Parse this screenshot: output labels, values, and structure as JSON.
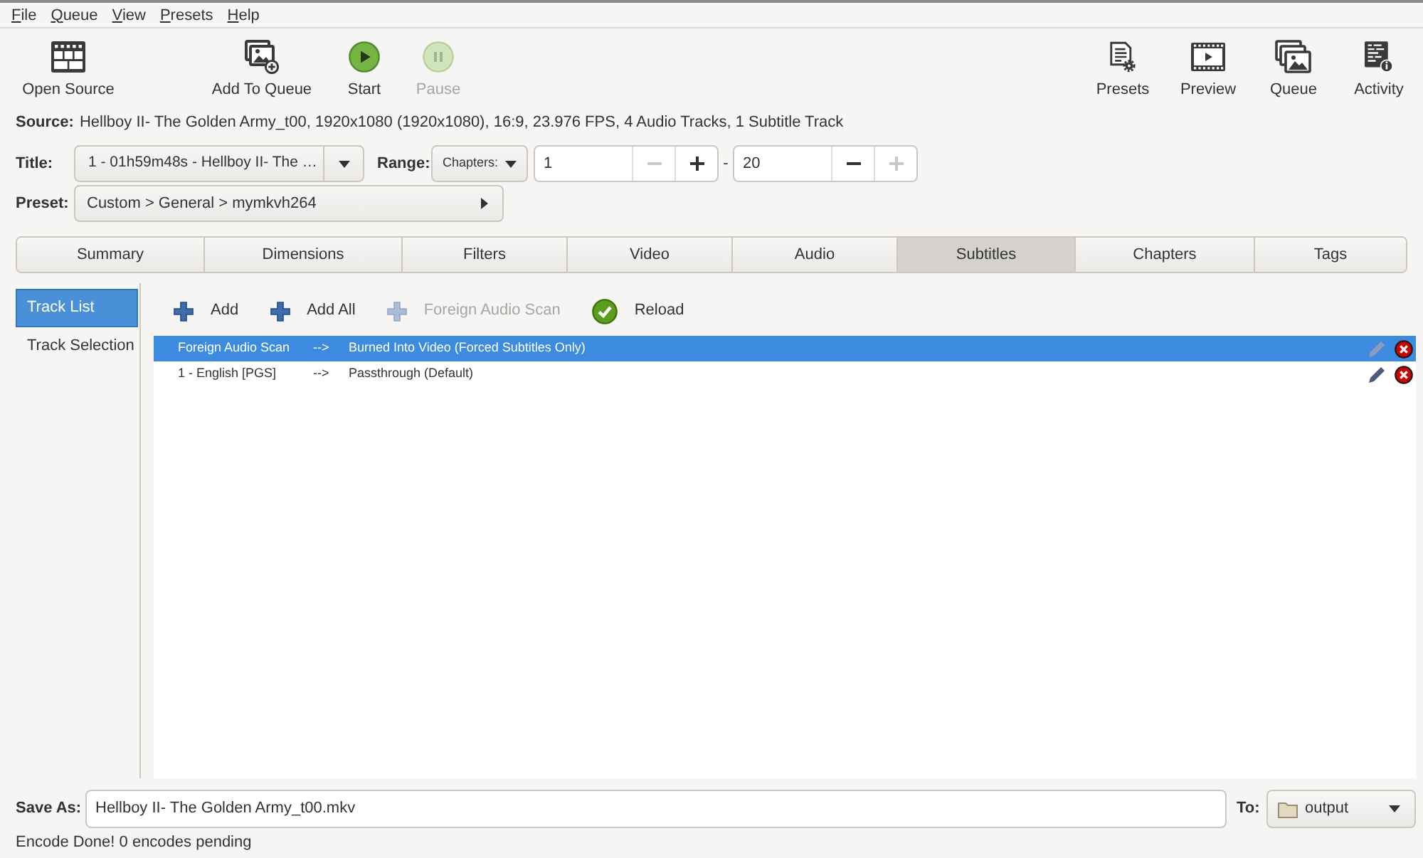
{
  "menu": [
    "File",
    "Queue",
    "View",
    "Presets",
    "Help"
  ],
  "toolbar": {
    "left": [
      {
        "label": "Open Source",
        "disabled": false
      },
      {
        "label": "Add To Queue",
        "disabled": false
      },
      {
        "label": "Start",
        "disabled": false
      },
      {
        "label": "Pause",
        "disabled": true
      }
    ],
    "right": [
      {
        "label": "Presets",
        "disabled": false
      },
      {
        "label": "Preview",
        "disabled": false
      },
      {
        "label": "Queue",
        "disabled": false
      },
      {
        "label": "Activity",
        "disabled": false
      }
    ]
  },
  "source": {
    "label": "Source:",
    "value": "Hellboy II- The Golden Army_t00, 1920x1080 (1920x1080), 16:9, 23.976 FPS, 4 Audio Tracks, 1 Subtitle Track"
  },
  "title": {
    "label": "Title:",
    "value": "1 - 01h59m48s - Hellboy II- The …"
  },
  "range": {
    "label": "Range:",
    "mode": "Chapters:",
    "start": {
      "value": "1",
      "decrement_disabled": true,
      "increment_disabled": false
    },
    "separator": "-",
    "end": {
      "value": "20",
      "decrement_disabled": false,
      "increment_disabled": true
    }
  },
  "preset": {
    "label": "Preset:",
    "value": "Custom > General > mymkvh264"
  },
  "tabs": [
    {
      "label": "Summary",
      "selected": false
    },
    {
      "label": "Dimensions",
      "selected": false
    },
    {
      "label": "Filters",
      "selected": false
    },
    {
      "label": "Video",
      "selected": false
    },
    {
      "label": "Audio",
      "selected": false
    },
    {
      "label": "Subtitles",
      "selected": true
    },
    {
      "label": "Chapters",
      "selected": false
    },
    {
      "label": "Tags",
      "selected": false
    }
  ],
  "sidebar": [
    {
      "label": "Track List",
      "selected": true
    },
    {
      "label": "Track Selection",
      "selected": false
    }
  ],
  "subtitle_toolbar": [
    {
      "label": "Add",
      "disabled": false
    },
    {
      "label": "Add All",
      "disabled": false
    },
    {
      "label": "Foreign Audio Scan",
      "disabled": true
    },
    {
      "label": "Reload",
      "disabled": false
    }
  ],
  "tracks": [
    {
      "source": "Foreign Audio Scan",
      "arrow": "-->",
      "output": "Burned Into Video (Forced Subtitles Only)",
      "selected": true
    },
    {
      "source": "1 - English [PGS]",
      "arrow": "-->",
      "output": "Passthrough (Default)",
      "selected": false
    }
  ],
  "save_as": {
    "label": "Save As:",
    "value": "Hellboy II- The Golden Army_t00.mkv"
  },
  "destination": {
    "label": "To:",
    "value": "output"
  },
  "status_bar": "Encode Done! 0 encodes pending"
}
